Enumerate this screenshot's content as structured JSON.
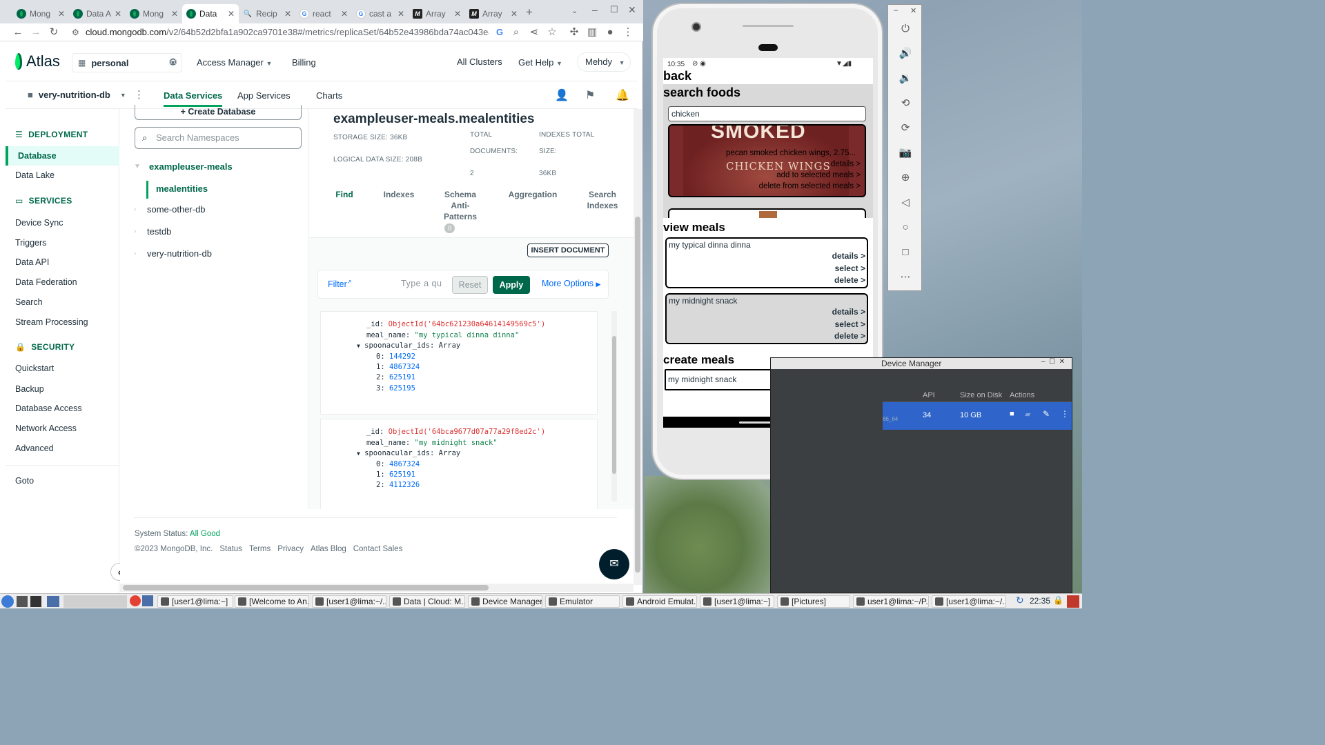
{
  "chrome": {
    "tabs": [
      {
        "title": "Mong",
        "icon": "mongodb-icon",
        "active": false
      },
      {
        "title": "Data A",
        "icon": "mongodb-icon",
        "active": false
      },
      {
        "title": "Mong",
        "icon": "mongodb-icon",
        "active": false
      },
      {
        "title": "Data",
        "icon": "mongodb-icon",
        "active": true
      },
      {
        "title": "Recip",
        "icon": "search-icon",
        "active": false
      },
      {
        "title": "react",
        "icon": "google-icon",
        "active": false
      },
      {
        "title": "cast a",
        "icon": "google-icon",
        "active": false
      },
      {
        "title": "Array",
        "icon": "mdn-icon",
        "active": false
      },
      {
        "title": "Array",
        "icon": "mdn-icon",
        "active": false
      }
    ],
    "url_host": "cloud.mongodb.com",
    "url_path": "/v2/64b52d2bfa1a902ca9701e38#/metrics/replicaSet/64b52e43986bda74ac043e46/e..."
  },
  "atlas": {
    "logo": "Atlas",
    "org": "personal",
    "top_nav": {
      "access_manager": "Access Manager",
      "billing": "Billing",
      "all_clusters": "All Clusters",
      "get_help": "Get Help",
      "user": "Mehdy"
    },
    "project": "very-nutrition-db",
    "sub_nav": {
      "data_services": "Data Services",
      "app_services": "App Services",
      "charts": "Charts"
    },
    "sidebar": {
      "deployment_header": "DEPLOYMENT",
      "services_header": "SERVICES",
      "security_header": "SECURITY",
      "deployment_items": [
        "Database",
        "Data Lake"
      ],
      "services_items": [
        "Device Sync",
        "Triggers",
        "Data API",
        "Data Federation",
        "Search",
        "Stream Processing"
      ],
      "security_items": [
        "Quickstart",
        "Backup",
        "Database Access",
        "Network Access",
        "Advanced"
      ],
      "goto": "Goto"
    },
    "namespaces": {
      "create_db": "+ Create Database",
      "search_placeholder": "Search Namespaces",
      "dbs": [
        "exampleuser-meals",
        "some-other-db",
        "testdb",
        "very-nutrition-db"
      ],
      "collection": "mealentities"
    },
    "collection": {
      "title": "exampleuser-meals.mealentities",
      "storage_size": "STORAGE SIZE: 36KB",
      "logical_size": "LOGICAL DATA SIZE: 208B",
      "total_docs_label_1": "TOTAL",
      "total_docs_label_2": "DOCUMENTS:",
      "total_docs": "2",
      "indexes_label_1": "INDEXES TOTAL",
      "indexes_label_2": "SIZE:",
      "indexes_size": "36KB",
      "tabs": {
        "find": "Find",
        "indexes": "Indexes",
        "schema": "Schema Anti-Patterns",
        "schema_badge": "0",
        "aggregation": "Aggregation",
        "search_indexes": "Search Indexes"
      },
      "insert_document": "INSERT DOCUMENT",
      "filter": {
        "label": "Filter",
        "placeholder": "Type a qu",
        "reset": "Reset",
        "apply": "Apply",
        "more_options": "More Options"
      },
      "documents": [
        {
          "id": "ObjectId('64bc621230a64614149569c5')",
          "meal_name": "\"my typical dinna dinna\"",
          "array_label": "Array",
          "ids": [
            "144292",
            "4867324",
            "625191",
            "625195"
          ]
        },
        {
          "id": "ObjectId('64bca9677d07a77a29f8ed2c')",
          "meal_name": "\"my midnight snack\"",
          "array_label": "Array",
          "ids": [
            "4867324",
            "625191",
            "4112326"
          ]
        }
      ],
      "keys": {
        "id": "_id:",
        "meal_name": "meal_name:",
        "spoon": "spoonacular_ids:"
      }
    },
    "footer": {
      "status_label": "System Status:",
      "status_value": "All Good",
      "copyright": "©2023 MongoDB, Inc.",
      "links": [
        "Status",
        "Terms",
        "Privacy",
        "Atlas Blog",
        "Contact Sales"
      ]
    }
  },
  "phone": {
    "time": "10:35",
    "back": "back",
    "search_title": "search foods",
    "search_value": "chicken",
    "food_title": "pecan smoked chicken wings, 2.75...",
    "food_actions": [
      "details >",
      "add to selected meals >",
      "delete from selected meals >"
    ],
    "food_image_text": [
      "SMOKED",
      "CHICKEN WINGS"
    ],
    "view_meals_title": "view meals",
    "meals": [
      {
        "name": "my typical dinna dinna",
        "actions": [
          "details >",
          "select >",
          "delete >"
        ]
      },
      {
        "name": "my midnight snack",
        "actions": [
          "details >",
          "select >",
          "delete >"
        ]
      }
    ],
    "create_title": "create meals",
    "create_value": "my midnight snack",
    "create_button": "+"
  },
  "device_manager": {
    "title": "Device Manager",
    "columns": [
      "API",
      "Size on Disk",
      "Actions"
    ],
    "row": {
      "api": "34",
      "size": "10 GB",
      "abi": "86_64"
    }
  },
  "taskbar": {
    "items": [
      "[user1@lima:~]",
      "[Welcome to An...",
      "[user1@lima:~/...",
      "Data | Cloud: M...",
      "Device Manager",
      "Emulator",
      "Android Emulat...",
      "[user1@lima:~]",
      "[Pictures]",
      "user1@lima:~/P...",
      "[user1@lima:~/..."
    ],
    "clock": "22:35"
  }
}
